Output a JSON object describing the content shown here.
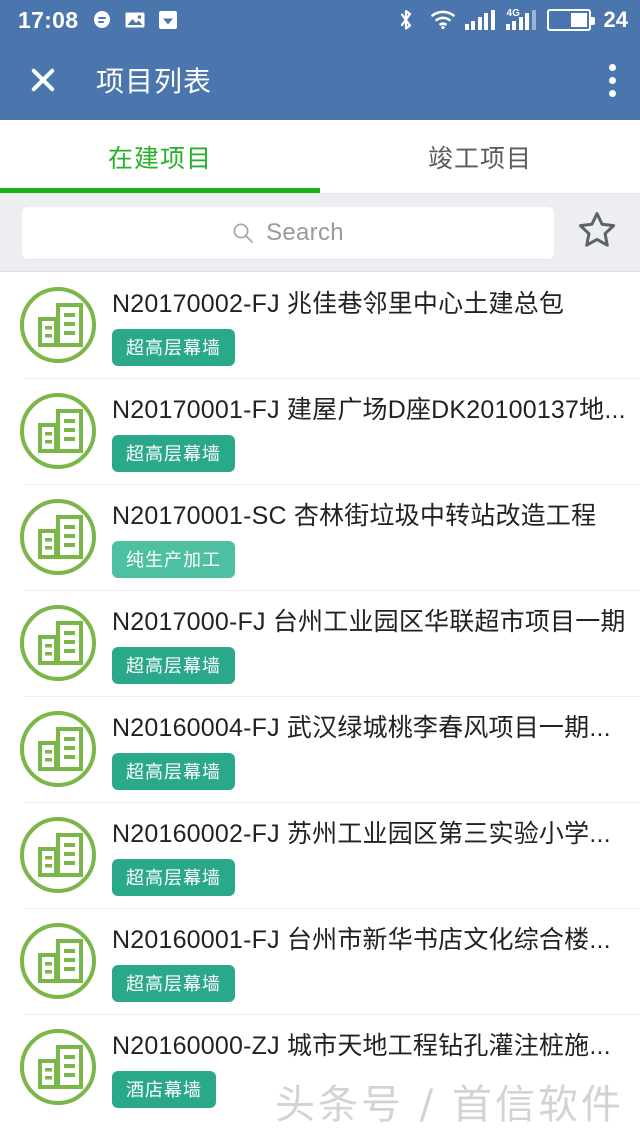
{
  "theme": {
    "header_blue": "#4b76ad",
    "tab_active_green": "#26b226",
    "tab_indicator_green": "#19b319",
    "icon_green": "#7ab648",
    "badge_teal": "#2aa98a",
    "badge_teal_light": "#4cc0a0",
    "page_bg": "#ffffff",
    "search_band_bg": "#eceef1"
  },
  "statusbar": {
    "time": "17:08",
    "left_icons": [
      "message-icon",
      "image-icon",
      "shield-download-icon"
    ],
    "bluetooth_icon": "bluetooth-icon",
    "wifi_icon": "wifi-icon",
    "signal_icon": "signal-bars-icon",
    "network_label": "4G",
    "network_icon": "signal-bars-4g-icon",
    "battery_icon": "battery-icon",
    "battery_level": "24"
  },
  "appbar": {
    "close_icon": "close-icon",
    "title": "项目列表",
    "overflow_icon": "more-vertical-icon"
  },
  "tabs": [
    {
      "label": "在建项目",
      "active": true
    },
    {
      "label": "竣工项目",
      "active": false
    }
  ],
  "search": {
    "icon": "search-icon",
    "placeholder": "Search",
    "value": "",
    "favorite_icon": "star-outline-icon"
  },
  "list": {
    "row_icon": "building-circle-icon",
    "items": [
      {
        "title": "N20170002-FJ 兆佳巷邻里中心土建总包",
        "badge": "超高层幕墙",
        "badge_color": "#2aa98a"
      },
      {
        "title": "N20170001-FJ 建屋广场D座DK20100137地...",
        "badge": "超高层幕墙",
        "badge_color": "#2aa98a"
      },
      {
        "title": "N20170001-SC 杏林街垃圾中转站改造工程",
        "badge": "纯生产加工",
        "badge_color": "#4cc0a0"
      },
      {
        "title": "N2017000-FJ 台州工业园区华联超市项目一期",
        "badge": "超高层幕墙",
        "badge_color": "#2aa98a"
      },
      {
        "title": "N20160004-FJ 武汉绿城桃李春风项目一期...",
        "badge": "超高层幕墙",
        "badge_color": "#2aa98a"
      },
      {
        "title": "N20160002-FJ 苏州工业园区第三实验小学...",
        "badge": "超高层幕墙",
        "badge_color": "#2aa98a"
      },
      {
        "title": "N20160001-FJ 台州市新华书店文化综合楼...",
        "badge": "超高层幕墙",
        "badge_color": "#2aa98a"
      },
      {
        "title": "N20160000-ZJ 城市天地工程钻孔灌注桩施...",
        "badge": "酒店幕墙",
        "badge_color": "#2aa98a"
      }
    ]
  },
  "watermark": {
    "text": "头条号 / 首信软件"
  }
}
